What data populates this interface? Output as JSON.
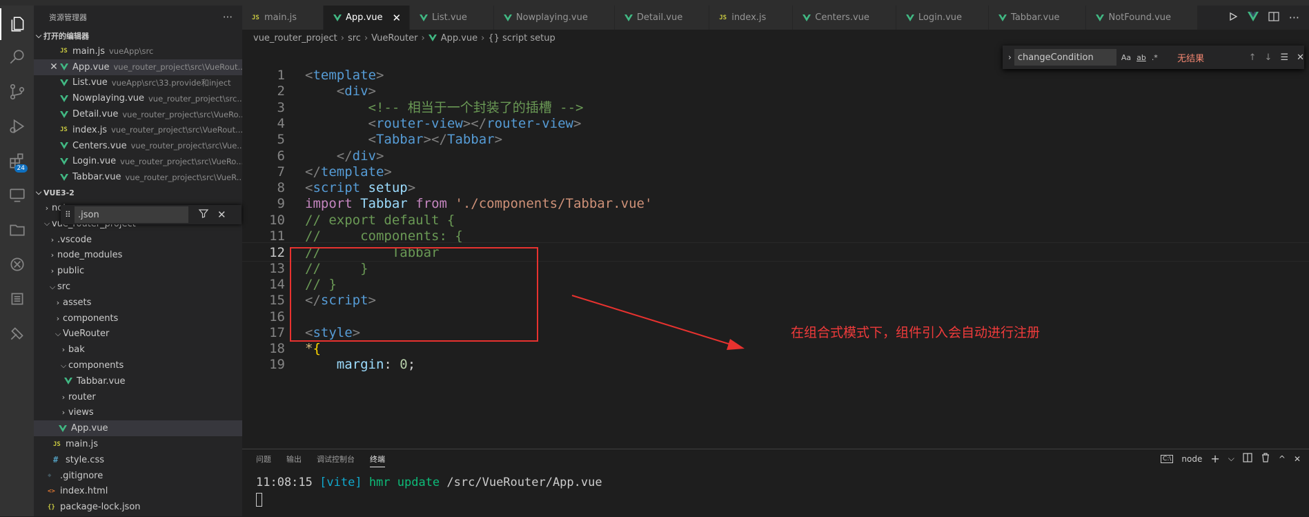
{
  "sidebar": {
    "title": "资源管理器",
    "open_editors_label": "打开的编辑器",
    "open_editors": [
      {
        "name": "main.js",
        "desc": "vueApp\\src",
        "type": "js"
      },
      {
        "name": "App.vue",
        "desc": "vue_router_project\\src\\VueRout...",
        "type": "vue",
        "active": true
      },
      {
        "name": "List.vue",
        "desc": "vueApp\\src\\33.provide和inject",
        "type": "vue"
      },
      {
        "name": "Nowplaying.vue",
        "desc": "vue_router_project\\src...",
        "type": "vue"
      },
      {
        "name": "Detail.vue",
        "desc": "vue_router_project\\src\\VueRo...",
        "type": "vue"
      },
      {
        "name": "index.js",
        "desc": "vue_router_project\\src\\VueRout...",
        "type": "js"
      },
      {
        "name": "Centers.vue",
        "desc": "vue_router_project\\src\\Vue...",
        "type": "vue"
      },
      {
        "name": "Login.vue",
        "desc": "vue_router_project\\src\\VueRo...",
        "type": "vue"
      },
      {
        "name": "Tabbar.vue",
        "desc": "vue_router_project\\src\\VueR...",
        "type": "vue"
      }
    ],
    "workspace_label": "VUE3-2",
    "filter_value": ".json",
    "tree": [
      {
        "name": "note",
        "kind": "folder-closed",
        "depth": 0
      },
      {
        "name": "vue_router_project",
        "kind": "folder-open",
        "depth": 0
      },
      {
        "name": ".vscode",
        "kind": "folder-closed",
        "depth": 1
      },
      {
        "name": "node_modules",
        "kind": "folder-closed",
        "depth": 1
      },
      {
        "name": "public",
        "kind": "folder-closed",
        "depth": 1
      },
      {
        "name": "src",
        "kind": "folder-open",
        "depth": 1
      },
      {
        "name": "assets",
        "kind": "folder-closed",
        "depth": 2
      },
      {
        "name": "components",
        "kind": "folder-closed",
        "depth": 2
      },
      {
        "name": "VueRouter",
        "kind": "folder-open",
        "depth": 2
      },
      {
        "name": "bak",
        "kind": "folder-closed",
        "depth": 3
      },
      {
        "name": "components",
        "kind": "folder-open",
        "depth": 3
      },
      {
        "name": "Tabbar.vue",
        "kind": "vue",
        "depth": 4
      },
      {
        "name": "router",
        "kind": "folder-closed",
        "depth": 3
      },
      {
        "name": "views",
        "kind": "folder-closed",
        "depth": 3
      },
      {
        "name": "App.vue",
        "kind": "vue",
        "depth": 3,
        "selected": true
      },
      {
        "name": "main.js",
        "kind": "js",
        "depth": 2
      },
      {
        "name": "style.css",
        "kind": "css",
        "depth": 2
      },
      {
        "name": ".gitignore",
        "kind": "git",
        "depth": 1
      },
      {
        "name": "index.html",
        "kind": "html",
        "depth": 1
      },
      {
        "name": "package-lock.json",
        "kind": "json",
        "depth": 1
      }
    ]
  },
  "tabs": [
    {
      "label": "main.js",
      "type": "js"
    },
    {
      "label": "App.vue",
      "type": "vue",
      "active": true
    },
    {
      "label": "List.vue",
      "type": "vue"
    },
    {
      "label": "Nowplaying.vue",
      "type": "vue"
    },
    {
      "label": "Detail.vue",
      "type": "vue"
    },
    {
      "label": "index.js",
      "type": "js"
    },
    {
      "label": "Centers.vue",
      "type": "vue"
    },
    {
      "label": "Login.vue",
      "type": "vue"
    },
    {
      "label": "Tabbar.vue",
      "type": "vue"
    },
    {
      "label": "NotFound.vue",
      "type": "vue"
    }
  ],
  "breadcrumb": [
    "vue_router_project",
    "src",
    "VueRouter",
    "App.vue",
    "{} script setup"
  ],
  "find": {
    "value": "changeCondition",
    "opt_case": "Aa",
    "opt_word": "ab",
    "opt_regex": ".*",
    "result": "无结果"
  },
  "code_lines": [
    {
      "n": "1",
      "tokens": [
        [
          "punc",
          "<"
        ],
        [
          "tag",
          "template"
        ],
        [
          "punc",
          ">"
        ]
      ]
    },
    {
      "n": "2",
      "tokens": [
        [
          "text",
          "    "
        ],
        [
          "punc",
          "<"
        ],
        [
          "tag",
          "div"
        ],
        [
          "punc",
          ">"
        ]
      ]
    },
    {
      "n": "3",
      "tokens": [
        [
          "text",
          "        "
        ],
        [
          "comment",
          "<!-- 相当于一个封装了的插槽 -->"
        ]
      ]
    },
    {
      "n": "4",
      "tokens": [
        [
          "text",
          "        "
        ],
        [
          "punc",
          "<"
        ],
        [
          "tag",
          "router-view"
        ],
        [
          "punc",
          "></"
        ],
        [
          "tag",
          "router-view"
        ],
        [
          "punc",
          ">"
        ]
      ]
    },
    {
      "n": "5",
      "tokens": [
        [
          "text",
          "        "
        ],
        [
          "punc",
          "<"
        ],
        [
          "tag",
          "Tabbar"
        ],
        [
          "punc",
          "></"
        ],
        [
          "tag",
          "Tabbar"
        ],
        [
          "punc",
          ">"
        ]
      ]
    },
    {
      "n": "6",
      "tokens": [
        [
          "text",
          "    "
        ],
        [
          "punc",
          "</"
        ],
        [
          "tag",
          "div"
        ],
        [
          "punc",
          ">"
        ]
      ]
    },
    {
      "n": "7",
      "tokens": [
        [
          "punc",
          "</"
        ],
        [
          "tag",
          "template"
        ],
        [
          "punc",
          ">"
        ]
      ]
    },
    {
      "n": "8",
      "tokens": [
        [
          "punc",
          "<"
        ],
        [
          "tag",
          "script"
        ],
        [
          "text",
          " "
        ],
        [
          "attr",
          "setup"
        ],
        [
          "punc",
          ">"
        ]
      ]
    },
    {
      "n": "9",
      "tokens": [
        [
          "kw",
          "import"
        ],
        [
          "text",
          " "
        ],
        [
          "id",
          "Tabbar"
        ],
        [
          "text",
          " "
        ],
        [
          "kw",
          "from"
        ],
        [
          "text",
          " "
        ],
        [
          "str",
          "'./components/Tabbar.vue'"
        ]
      ]
    },
    {
      "n": "10",
      "tokens": [
        [
          "comment",
          "// export default {"
        ]
      ]
    },
    {
      "n": "11",
      "tokens": [
        [
          "comment",
          "//     components: {"
        ]
      ]
    },
    {
      "n": "12",
      "tokens": [
        [
          "comment",
          "//         Tabbar"
        ]
      ],
      "current": true
    },
    {
      "n": "13",
      "tokens": [
        [
          "comment",
          "//     }"
        ]
      ]
    },
    {
      "n": "14",
      "tokens": [
        [
          "comment",
          "// }"
        ]
      ]
    },
    {
      "n": "15",
      "tokens": [
        [
          "punc",
          "</"
        ],
        [
          "tag",
          "script"
        ],
        [
          "punc",
          ">"
        ]
      ]
    },
    {
      "n": "16",
      "tokens": []
    },
    {
      "n": "17",
      "tokens": [
        [
          "punc",
          "<"
        ],
        [
          "tag",
          "style"
        ],
        [
          "punc",
          ">"
        ]
      ]
    },
    {
      "n": "18",
      "tokens": [
        [
          "sel",
          "*"
        ],
        [
          "brace",
          "{"
        ]
      ]
    },
    {
      "n": "19",
      "tokens": [
        [
          "text",
          "    "
        ],
        [
          "id",
          "margin"
        ],
        [
          "text",
          ": "
        ],
        [
          "num",
          "0"
        ],
        [
          "text",
          ";"
        ]
      ]
    }
  ],
  "annotation": "在组合式模式下，组件引入会自动进行注册",
  "panel": {
    "tabs": [
      "问题",
      "输出",
      "调试控制台",
      "终端"
    ],
    "active_tab": "终端",
    "shell": "node",
    "terminal_time": "11:08:15",
    "terminal_tag": "[vite]",
    "terminal_msg": "hmr update",
    "terminal_path": "/src/VueRouter/App.vue"
  },
  "colors": {
    "accent": "#007acc",
    "annotation": "#f03b3b",
    "vue": "#41b883",
    "js": "#cbcb41"
  }
}
